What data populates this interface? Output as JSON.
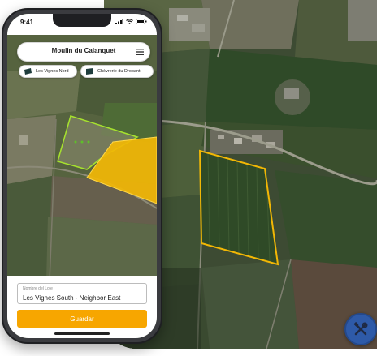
{
  "status": {
    "time": "9:41"
  },
  "header": {
    "title": "Moulin du Calanquet"
  },
  "chips": [
    {
      "label": "Les Vignes Nord"
    },
    {
      "label": "Chèvrerie du Drobant"
    }
  ],
  "form": {
    "field_label": "Nombre del Lote",
    "field_value": "Les Vignes South - Neighbor East",
    "save_label": "Guardar"
  },
  "colors": {
    "accent": "#f7a600",
    "selection_outline": "#a6e22e",
    "field_fill": "#f2b705",
    "fab": "#2e5aa8"
  },
  "icons": {
    "menu": "hamburger-icon",
    "tools": "tools-icon",
    "chip": "field-shape-icon"
  }
}
